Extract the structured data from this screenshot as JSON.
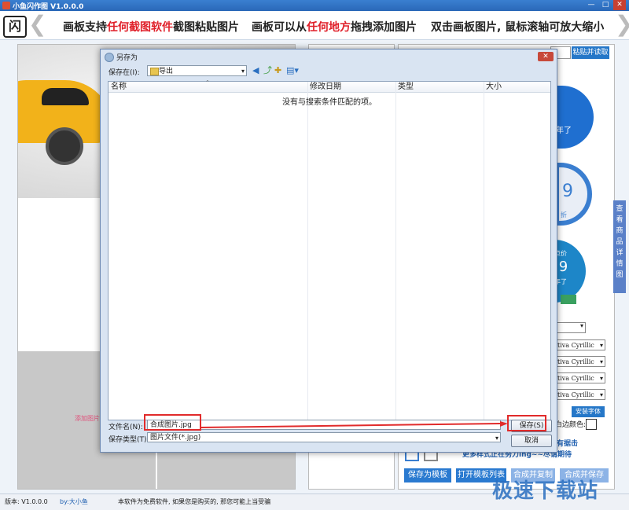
{
  "app": {
    "title": "小鱼闪作图 V1.0.0.0",
    "window_buttons": [
      "—",
      "□",
      "✕"
    ]
  },
  "banner": {
    "logo": "闪",
    "slogan_1": {
      "pre": "画板支持",
      "red": "任何截图软件",
      "post": "截图粘贴图片"
    },
    "slogan_2": {
      "pre": "画板可以从",
      "red": "任何地方",
      "post": "拖拽添加图片"
    },
    "slogan_3": "双击画板图片, 鼠标滚轴可放大缩小"
  },
  "right_panel": {
    "paste_button": "粘贴并读取",
    "font_selects": [
      "tiva Cyrillic",
      "tiva Cyrillic",
      "tiva Cyrillic",
      "tiva Cyrillic"
    ],
    "install_font_button": "安装字体",
    "border_color_label": "白边颜色:",
    "blue_text_1": "有据击",
    "blue_text_2": "更多样式正在努力ing~~尽请期待",
    "side_tab": "查看商品详情图",
    "bottom_buttons": [
      "保存为模板",
      "打开模板列表",
      "合成并复制",
      "合成并保存"
    ],
    "thumb_texts": [
      "年了",
      "9",
      "折",
      "点价",
      ".9",
      "年了"
    ]
  },
  "canvas": {
    "add_image_label": "添加图片"
  },
  "status": {
    "version": "版本: V1.0.0.0",
    "author": "by:大小鱼",
    "notice": "本软件为免费软件, 如果您是购买的, 那您可能上当受骗"
  },
  "dialog": {
    "title": "另存为",
    "close": "✕",
    "save_in_label": "保存在(I):",
    "save_in_value": "导出",
    "columns": [
      "名称",
      "修改日期",
      "类型",
      "大小"
    ],
    "empty_message": "没有与搜索条件匹配的项。",
    "filename_label": "文件名(N):",
    "filename_value": "合成图片.jpg",
    "filetype_label": "保存类型(T):",
    "filetype_value": "图片文件(*.jpg)",
    "save_button": "保存(S)",
    "cancel_button": "取消"
  },
  "watermark": "极速下载站",
  "colors": {
    "accent_blue": "#2a7ad0",
    "highlight_red": "#e12b2b",
    "slogan_red": "#e0202a"
  }
}
